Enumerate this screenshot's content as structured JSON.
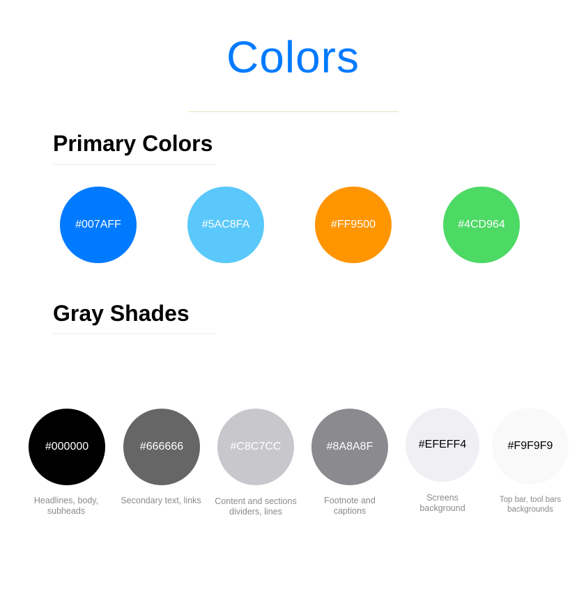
{
  "page": {
    "title": "Colors"
  },
  "primary": {
    "heading": "Primary Colors",
    "swatches": [
      {
        "hex": "#007AFF",
        "label": "#007AFF"
      },
      {
        "hex": "#5AC8FA",
        "label": "#5AC8FA"
      },
      {
        "hex": "#FF9500",
        "label": "#FF9500"
      },
      {
        "hex": "#4CD964",
        "label": "#4CD964"
      }
    ]
  },
  "gray": {
    "heading": "Gray Shades",
    "swatches": [
      {
        "hex": "#000000",
        "label": "#000000",
        "caption": "Headlines, body, subheads"
      },
      {
        "hex": "#666666",
        "label": "#666666",
        "caption": "Secondary text, links"
      },
      {
        "hex": "#C8C7CC",
        "label": "#C8C7CC",
        "caption": "Content and sections dividers, lines"
      },
      {
        "hex": "#8A8A8F",
        "label": "#8A8A8F",
        "caption": "Footnote and captions"
      },
      {
        "hex": "#EFEFF4",
        "label": "#EFEFF4",
        "caption": "Screens background"
      },
      {
        "hex": "#F9F9F9",
        "label": "#F9F9F9",
        "caption": "Top bar, tool bars backgrounds"
      }
    ]
  }
}
